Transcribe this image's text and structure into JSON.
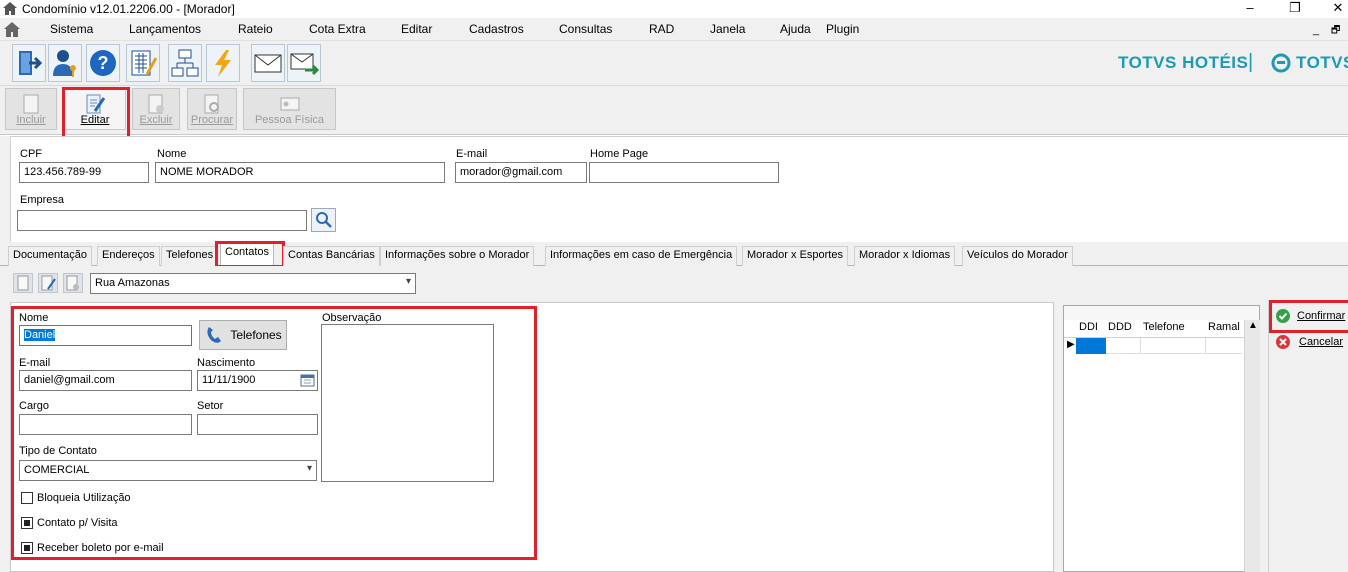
{
  "window": {
    "title": "Condomínio v12.01.2206.00 - [Morador]",
    "minimize": "‒",
    "restore": "❐",
    "close": "✕",
    "mdi_minimize": "_",
    "mdi_restore": "🗗"
  },
  "menu": [
    "Sistema",
    "Lançamentos",
    "Rateio",
    "Cota Extra",
    "Editar",
    "Cadastros",
    "Consultas",
    "RAD",
    "Janela",
    "Ajuda",
    "Plugin"
  ],
  "brand": {
    "totvs_hoteis": "TOTVS HOTÉIS",
    "separator": "|",
    "totvs": "TOTVS"
  },
  "toolbar2": {
    "incluir": "Incluir",
    "editar": "Editar",
    "excluir": "Excluir",
    "procurar": "Procurar",
    "pessoa_fisica": "Pessoa Física"
  },
  "header_form": {
    "cpf_label": "CPF",
    "cpf_value": "123.456.789-99",
    "nome_label": "Nome",
    "nome_value": "NOME MORADOR",
    "email_label": "E-mail",
    "email_value": "morador@gmail.com",
    "homepage_label": "Home Page",
    "homepage_value": "",
    "empresa_label": "Empresa",
    "empresa_value": ""
  },
  "tabs": [
    "Documentação",
    "Endereços",
    "Telefones",
    "Contatos",
    "Contas Bancárias",
    "Informações sobre o Morador",
    "Informações em caso de Emergência",
    "Morador x Esportes",
    "Morador x Idiomas",
    "Veículos do Morador"
  ],
  "active_tab": "Contatos",
  "address_select": "Rua Amazonas",
  "contact": {
    "nome_label": "Nome",
    "nome_value": "Daniel",
    "telefones_button": "Telefones",
    "observacao_label": "Observação",
    "email_label": "E-mail",
    "email_value": "daniel@gmail.com",
    "nascimento_label": "Nascimento",
    "nascimento_value": "11/11/1900",
    "cargo_label": "Cargo",
    "cargo_value": "",
    "setor_label": "Setor",
    "setor_value": "",
    "tipo_label": "Tipo de Contato",
    "tipo_value": "COMERCIAL",
    "bloqueia_label": "Bloqueia Utilização",
    "bloqueia_checked": false,
    "visita_label": "Contato p/ Visita",
    "visita_checked": true,
    "boleto_label": "Receber boleto por e-mail",
    "boleto_checked": true
  },
  "grid": {
    "columns": [
      "DDI",
      "DDD",
      "Telefone",
      "Ramal"
    ]
  },
  "actions": {
    "confirmar": "Confirmar",
    "cancelar": "Cancelar"
  },
  "colors": {
    "highlight": "#e0202a",
    "brand": "#1c9bb3",
    "selection": "#0078d7"
  }
}
